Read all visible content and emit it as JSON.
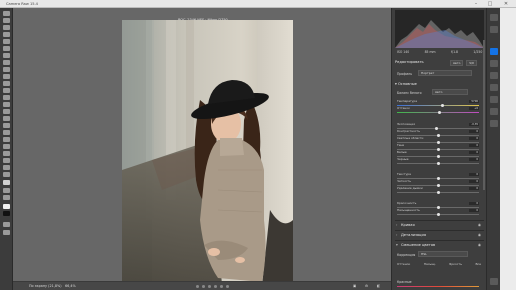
{
  "window": {
    "app_title": "Camera Raw 15.4",
    "controls": [
      "–",
      "□",
      "✕"
    ]
  },
  "file": {
    "title": "_BOC_2346.NEF  ·  Nikon D750"
  },
  "histogram": {
    "readout": [
      "ISO 140",
      "85 mm",
      "f/1.8",
      "1/250 с"
    ]
  },
  "panel": {
    "heading": "Редактировать",
    "auto_label": "Авто",
    "bw_label": "Ч/б",
    "profile_label": "Профиль",
    "profile_value": "Портрет",
    "basic_section": "Основные",
    "wb_label": "Баланс белого",
    "wb_value": "Авто",
    "sliders": [
      {
        "label": "Температура",
        "value": "5700",
        "pos": 0.55
      },
      {
        "label": "Оттенок",
        "value": "+6",
        "pos": 0.52
      },
      {
        "label": "Экспозиция",
        "value": "-0,35",
        "pos": 0.48
      },
      {
        "label": "Контрастность",
        "value": "0",
        "pos": 0.5
      },
      {
        "label": "Светлые области",
        "value": "0",
        "pos": 0.5
      },
      {
        "label": "Тени",
        "value": "0",
        "pos": 0.5
      },
      {
        "label": "Белые",
        "value": "0",
        "pos": 0.5
      },
      {
        "label": "Черные",
        "value": "0",
        "pos": 0.5
      },
      {
        "label": "Текстура",
        "value": "0",
        "pos": 0.5
      },
      {
        "label": "Четкость",
        "value": "0",
        "pos": 0.5
      },
      {
        "label": "Удаление дымки",
        "value": "0",
        "pos": 0.5
      },
      {
        "label": "Красочность",
        "value": "0",
        "pos": 0.5
      },
      {
        "label": "Насыщенность",
        "value": "0",
        "pos": 0.5
      }
    ],
    "collapsed_sections": [
      "Кривая",
      "Детализация",
      "Смешение цветов"
    ],
    "color_mixer": {
      "adjust_label": "Коррекция",
      "adjust_value": "HSL",
      "tabs": [
        "Оттенок",
        "Насыщ.",
        "Яркость",
        "Все"
      ],
      "first_row": "Красные"
    }
  },
  "status": {
    "zoom_label": "По экрану (21,8%)",
    "zoom_value": "66,4%"
  },
  "colors": {
    "accent": "#1473e6",
    "panel_bg": "#3e3e3e",
    "canvas_bg": "#676767"
  }
}
